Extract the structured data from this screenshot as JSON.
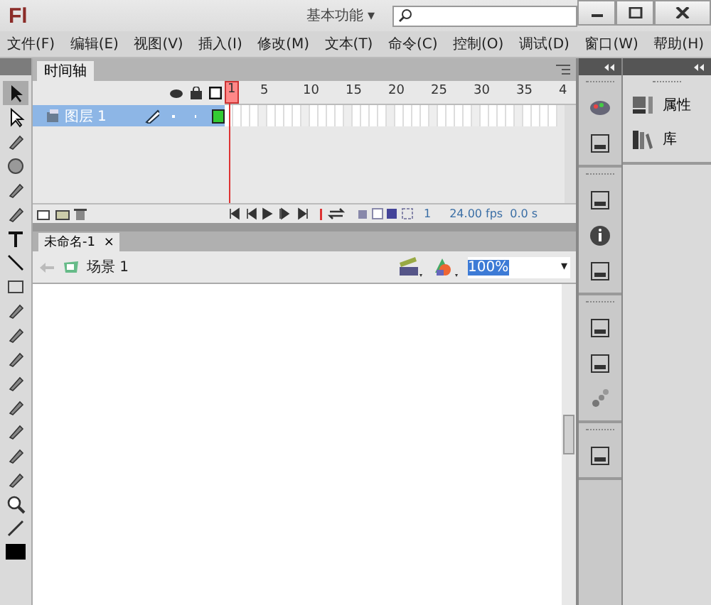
{
  "app": {
    "logo": "Fl",
    "workspace": "基本功能",
    "workspace_caret": "▾"
  },
  "window_buttons": [
    {
      "kind": "minimize"
    },
    {
      "kind": "maximize"
    },
    {
      "kind": "close"
    }
  ],
  "menu": [
    "文件(F)",
    "编辑(E)",
    "视图(V)",
    "插入(I)",
    "修改(M)",
    "文本(T)",
    "命令(C)",
    "控制(O)",
    "调试(D)",
    "窗口(W)",
    "帮助(H)"
  ],
  "timeline": {
    "tab": "时间轴",
    "ruler": [
      "1",
      "5",
      "10",
      "15",
      "20",
      "25",
      "30",
      "35",
      "4"
    ],
    "layers": [
      {
        "name": "图层 1",
        "selected": true
      }
    ],
    "current_frame": "1",
    "fps": "24.00 fps",
    "time": "0.0 s"
  },
  "document": {
    "tab": "未命名-1",
    "close": "×",
    "scene": "场景 1",
    "zoom": "100%",
    "zoom_caret": "▾"
  },
  "panels": [
    {
      "label": "属性",
      "kind": "properties"
    },
    {
      "label": "库",
      "kind": "library"
    }
  ]
}
